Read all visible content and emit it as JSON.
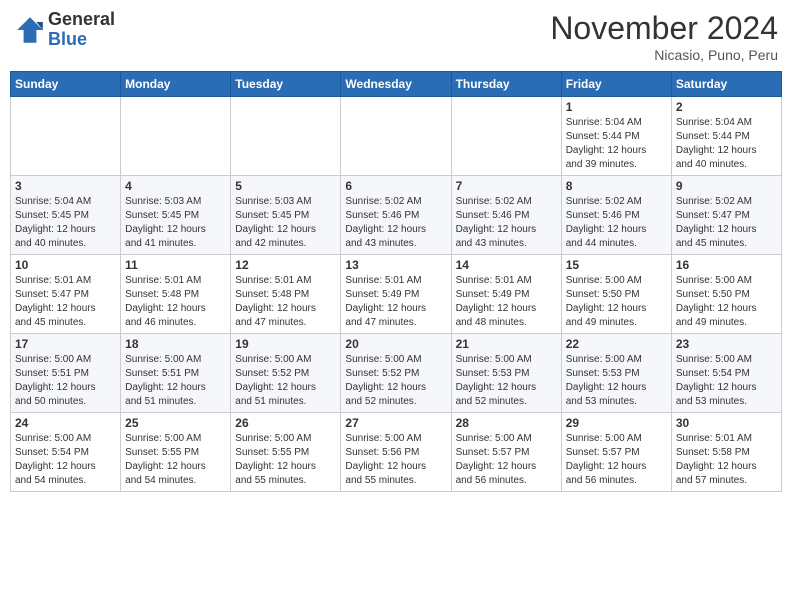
{
  "header": {
    "logo_general": "General",
    "logo_blue": "Blue",
    "month_title": "November 2024",
    "location": "Nicasio, Puno, Peru"
  },
  "weekdays": [
    "Sunday",
    "Monday",
    "Tuesday",
    "Wednesday",
    "Thursday",
    "Friday",
    "Saturday"
  ],
  "weeks": [
    [
      {
        "day": "",
        "info": ""
      },
      {
        "day": "",
        "info": ""
      },
      {
        "day": "",
        "info": ""
      },
      {
        "day": "",
        "info": ""
      },
      {
        "day": "",
        "info": ""
      },
      {
        "day": "1",
        "info": "Sunrise: 5:04 AM\nSunset: 5:44 PM\nDaylight: 12 hours\nand 39 minutes."
      },
      {
        "day": "2",
        "info": "Sunrise: 5:04 AM\nSunset: 5:44 PM\nDaylight: 12 hours\nand 40 minutes."
      }
    ],
    [
      {
        "day": "3",
        "info": "Sunrise: 5:04 AM\nSunset: 5:45 PM\nDaylight: 12 hours\nand 40 minutes."
      },
      {
        "day": "4",
        "info": "Sunrise: 5:03 AM\nSunset: 5:45 PM\nDaylight: 12 hours\nand 41 minutes."
      },
      {
        "day": "5",
        "info": "Sunrise: 5:03 AM\nSunset: 5:45 PM\nDaylight: 12 hours\nand 42 minutes."
      },
      {
        "day": "6",
        "info": "Sunrise: 5:02 AM\nSunset: 5:46 PM\nDaylight: 12 hours\nand 43 minutes."
      },
      {
        "day": "7",
        "info": "Sunrise: 5:02 AM\nSunset: 5:46 PM\nDaylight: 12 hours\nand 43 minutes."
      },
      {
        "day": "8",
        "info": "Sunrise: 5:02 AM\nSunset: 5:46 PM\nDaylight: 12 hours\nand 44 minutes."
      },
      {
        "day": "9",
        "info": "Sunrise: 5:02 AM\nSunset: 5:47 PM\nDaylight: 12 hours\nand 45 minutes."
      }
    ],
    [
      {
        "day": "10",
        "info": "Sunrise: 5:01 AM\nSunset: 5:47 PM\nDaylight: 12 hours\nand 45 minutes."
      },
      {
        "day": "11",
        "info": "Sunrise: 5:01 AM\nSunset: 5:48 PM\nDaylight: 12 hours\nand 46 minutes."
      },
      {
        "day": "12",
        "info": "Sunrise: 5:01 AM\nSunset: 5:48 PM\nDaylight: 12 hours\nand 47 minutes."
      },
      {
        "day": "13",
        "info": "Sunrise: 5:01 AM\nSunset: 5:49 PM\nDaylight: 12 hours\nand 47 minutes."
      },
      {
        "day": "14",
        "info": "Sunrise: 5:01 AM\nSunset: 5:49 PM\nDaylight: 12 hours\nand 48 minutes."
      },
      {
        "day": "15",
        "info": "Sunrise: 5:00 AM\nSunset: 5:50 PM\nDaylight: 12 hours\nand 49 minutes."
      },
      {
        "day": "16",
        "info": "Sunrise: 5:00 AM\nSunset: 5:50 PM\nDaylight: 12 hours\nand 49 minutes."
      }
    ],
    [
      {
        "day": "17",
        "info": "Sunrise: 5:00 AM\nSunset: 5:51 PM\nDaylight: 12 hours\nand 50 minutes."
      },
      {
        "day": "18",
        "info": "Sunrise: 5:00 AM\nSunset: 5:51 PM\nDaylight: 12 hours\nand 51 minutes."
      },
      {
        "day": "19",
        "info": "Sunrise: 5:00 AM\nSunset: 5:52 PM\nDaylight: 12 hours\nand 51 minutes."
      },
      {
        "day": "20",
        "info": "Sunrise: 5:00 AM\nSunset: 5:52 PM\nDaylight: 12 hours\nand 52 minutes."
      },
      {
        "day": "21",
        "info": "Sunrise: 5:00 AM\nSunset: 5:53 PM\nDaylight: 12 hours\nand 52 minutes."
      },
      {
        "day": "22",
        "info": "Sunrise: 5:00 AM\nSunset: 5:53 PM\nDaylight: 12 hours\nand 53 minutes."
      },
      {
        "day": "23",
        "info": "Sunrise: 5:00 AM\nSunset: 5:54 PM\nDaylight: 12 hours\nand 53 minutes."
      }
    ],
    [
      {
        "day": "24",
        "info": "Sunrise: 5:00 AM\nSunset: 5:54 PM\nDaylight: 12 hours\nand 54 minutes."
      },
      {
        "day": "25",
        "info": "Sunrise: 5:00 AM\nSunset: 5:55 PM\nDaylight: 12 hours\nand 54 minutes."
      },
      {
        "day": "26",
        "info": "Sunrise: 5:00 AM\nSunset: 5:55 PM\nDaylight: 12 hours\nand 55 minutes."
      },
      {
        "day": "27",
        "info": "Sunrise: 5:00 AM\nSunset: 5:56 PM\nDaylight: 12 hours\nand 55 minutes."
      },
      {
        "day": "28",
        "info": "Sunrise: 5:00 AM\nSunset: 5:57 PM\nDaylight: 12 hours\nand 56 minutes."
      },
      {
        "day": "29",
        "info": "Sunrise: 5:00 AM\nSunset: 5:57 PM\nDaylight: 12 hours\nand 56 minutes."
      },
      {
        "day": "30",
        "info": "Sunrise: 5:01 AM\nSunset: 5:58 PM\nDaylight: 12 hours\nand 57 minutes."
      }
    ]
  ]
}
